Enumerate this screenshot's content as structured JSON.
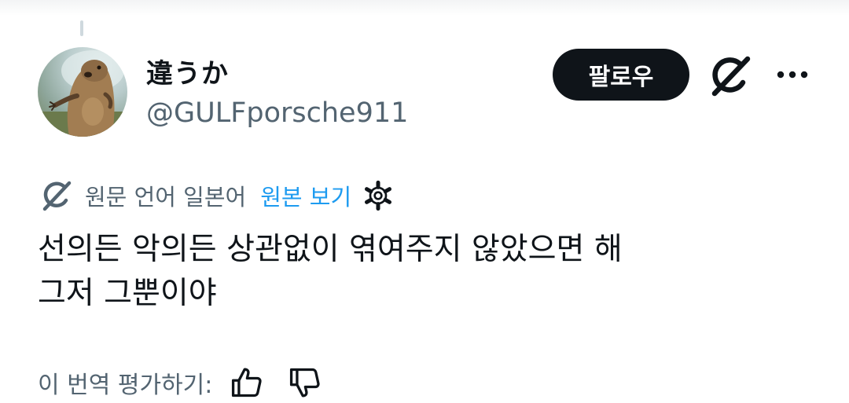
{
  "author": {
    "display_name": "違うか",
    "handle": "@GULFporsche911"
  },
  "follow_label": "팔로우",
  "icons": {
    "grok": "grok-icon",
    "more": "more-dots-icon",
    "translate": "translate-icon",
    "settings": "gear-icon",
    "thumbs_up": "thumbs-up-icon",
    "thumbs_down": "thumbs-down-icon"
  },
  "translation": {
    "source_language": "원문 언어 일본어",
    "view_original": "원본 보기"
  },
  "tweet": {
    "line1": "선의든 악의든 상관없이 엮여주지 않았으면 해",
    "line2": "그저 그뿐이야"
  },
  "rating": {
    "label": "이 번역 평가하기:"
  },
  "colors": {
    "text": "#0f1419",
    "secondary": "#536471",
    "link": "#1d9bf0",
    "button_bg": "#0f1419",
    "button_text": "#ffffff"
  }
}
